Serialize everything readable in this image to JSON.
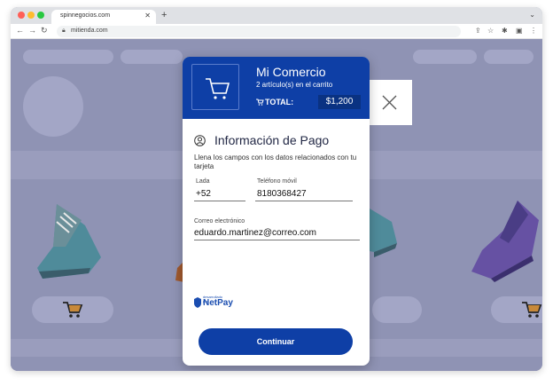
{
  "browser": {
    "tab_title": "spinnegocios.com",
    "url": "mitienda.com",
    "traffic_colors": [
      "#ff5f57",
      "#febc2e",
      "#28c840"
    ]
  },
  "modal": {
    "shop_name": "Mi Comercio",
    "item_count": "2 artículo(s) en el carrito",
    "total_label": "TOTAL:",
    "total_value": "$1,200",
    "section_title": "Información de Pago",
    "description": "Llena los campos con los datos relacionados con tu tarjeta",
    "lada_label": "Lada",
    "lada_value": "+52",
    "phone_label": "Teléfono móvil",
    "phone_value": "8180368427",
    "email_label": "Correo electrónico",
    "email_value": "eduardo.martinez@correo.com",
    "powered_by": "desarrollado por",
    "netpay": "NetPay",
    "continue_label": "Continuar"
  },
  "colors": {
    "primary": "#0e3fa6",
    "backdrop": "#8f93b4"
  }
}
